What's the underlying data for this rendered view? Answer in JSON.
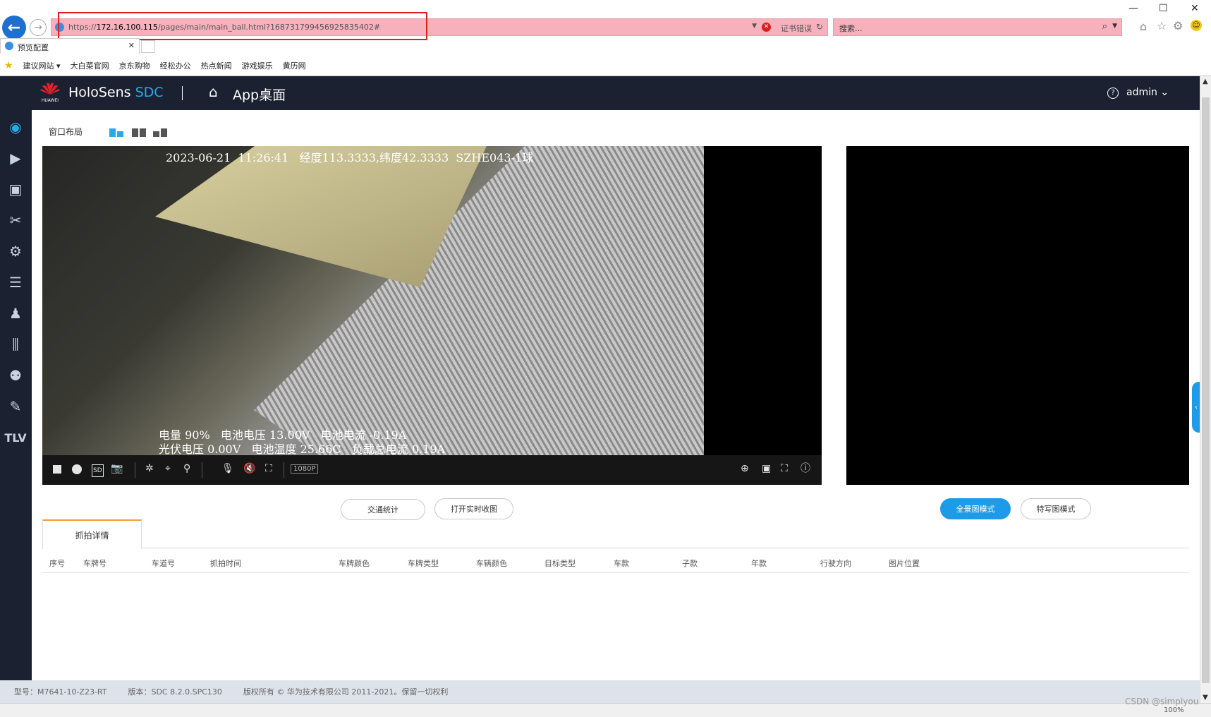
{
  "browser": {
    "url_prefix": "https://",
    "url_host": "172.16.100.115",
    "url_path": "/pages/main/main_ball.html?168731799456925835402#",
    "cert_error": "证书错误",
    "search_placeholder": "搜索...",
    "tab_title": "预览配置",
    "favorites": [
      "建议网站 ▾",
      "大白菜官网",
      "京东购物",
      "经松办公",
      "热点新闻",
      "游戏娱乐",
      "黄历网"
    ],
    "zoom": "100%"
  },
  "header": {
    "brand_text": "HUAWEI",
    "product": "HoloSens",
    "product_accent": "SDC",
    "page_title": "App桌面",
    "user": "admin",
    "accent_color": "#29a9e8"
  },
  "layout": {
    "label": "窗口布局"
  },
  "video": {
    "osd_top": "2023-06-21  11:26:41   经度113.3333,纬度42.3333  SZHE043-1球",
    "osd_line1": "电量 90%   电池电压 13.00V   电池电流 -0.19A",
    "osd_line2": "光伏电压 0.00V   电池温度 25.66C   负载总电流 0.19A",
    "resolution": "1080P"
  },
  "buttons": {
    "traffic_stats": "交通统计",
    "open_realtime": "打开实时收图",
    "panorama_mode": "全景图模式",
    "closeup_mode": "特写图模式"
  },
  "capture": {
    "tab_label": "抓拍详情",
    "columns": [
      "序号",
      "车牌号",
      "车道号",
      "抓拍时间",
      "车牌颜色",
      "车牌类型",
      "车辆颜色",
      "目标类型",
      "车款",
      "子款",
      "年款",
      "行驶方向",
      "图片位置"
    ]
  },
  "footer": {
    "model": "型号：M7641-10-Z23-RT",
    "version": "版本：SDC 8.2.0.SPC130",
    "copyright": "版权所有 © 华为技术有限公司 2011-2021。保留一切权利"
  },
  "watermark": "CSDN @simplyou"
}
